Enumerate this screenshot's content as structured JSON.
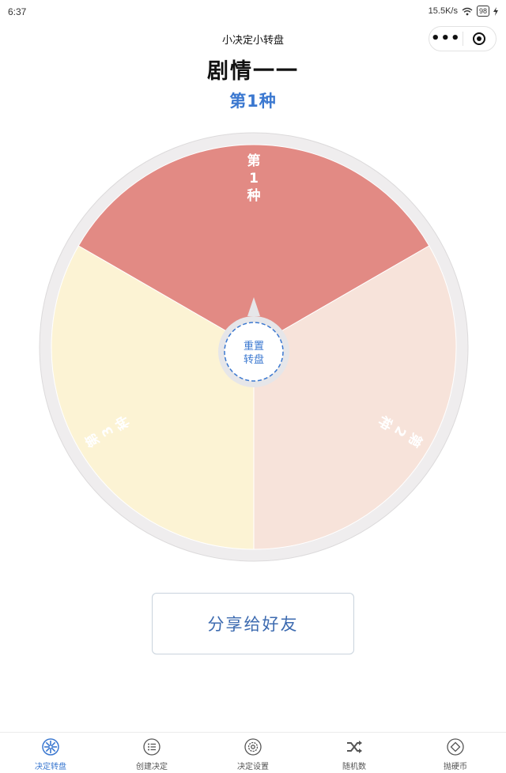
{
  "status_bar": {
    "time": "6:37",
    "network_speed": "15.5K/s",
    "battery": "98"
  },
  "nav": {
    "title": "小决定小转盘",
    "more_icon": "more-dots-icon",
    "close_icon": "target-icon"
  },
  "decision_title": "剧情一一",
  "result_label": "第1种",
  "wheel": {
    "segments": [
      {
        "label": "第1种",
        "color": "#e28a84",
        "text_color": "#ffffff"
      },
      {
        "label": "第2种",
        "color": "#f7e3da",
        "text_color": "#ffffff"
      },
      {
        "label": "第3种",
        "color": "#fcf3d4",
        "text_color": "#ffffff"
      }
    ],
    "rim_color": "#efedee",
    "center_button": {
      "line1": "重置",
      "line2": "转盘",
      "color": "#3b78d0"
    }
  },
  "share_button": {
    "label": "分享给好友"
  },
  "tabs": [
    {
      "label": "决定转盘",
      "icon": "spinner-wheel-icon",
      "active": true
    },
    {
      "label": "创建决定",
      "icon": "list-icon",
      "active": false
    },
    {
      "label": "决定设置",
      "icon": "settings-gear-icon",
      "active": false
    },
    {
      "label": "随机数",
      "icon": "shuffle-icon",
      "active": false
    },
    {
      "label": "抛硬币",
      "icon": "coin-icon",
      "active": false
    }
  ],
  "colors": {
    "accent": "#3b78d0",
    "text": "#111111"
  }
}
